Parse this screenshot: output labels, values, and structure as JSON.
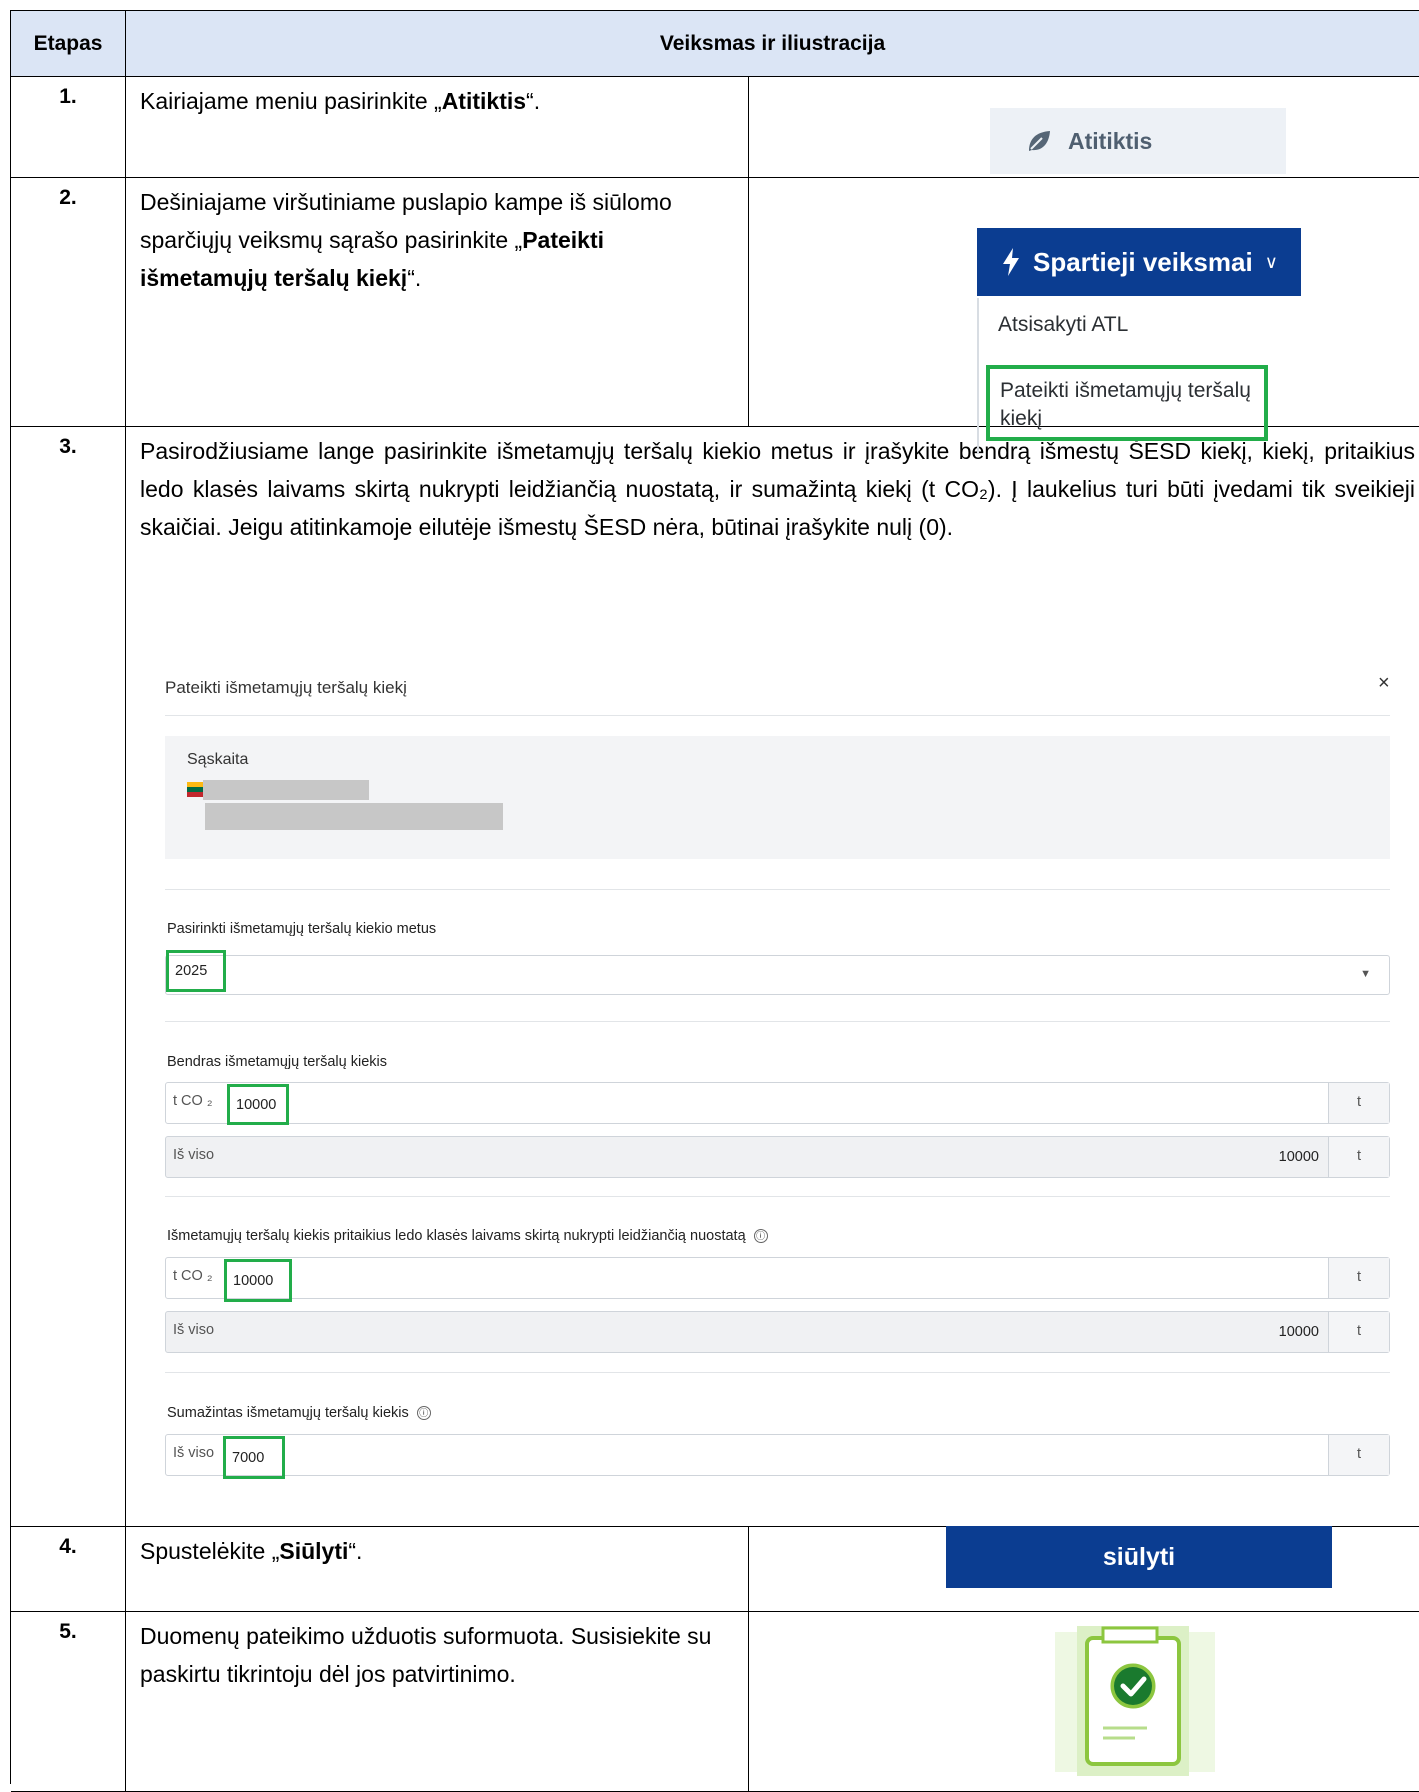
{
  "header": {
    "col1": "Etapas",
    "col2": "Veiksmas ir iliustracija"
  },
  "steps": [
    {
      "num": "1.",
      "pre": "Kairiajame meniu pasirinkite „",
      "bold": "Atitiktis",
      "post": "“."
    },
    {
      "num": "2.",
      "pre": "Dešiniajame viršutiniame puslapio kampe  iš siūlomo sparčiųjų veiksmų sąrašo pasirinkite „",
      "bold": "Pateikti išmetamųjų teršalų kiekį",
      "post": "“."
    },
    {
      "num": "3.",
      "text": "Pasirodžiusiame lange pasirinkite išmetamųjų teršalų kiekio metus ir įrašykite bendrą išmestų ŠESD kiekį, kiekį, pritaikius ledo klasės laivams skirtą nukrypti leidžiančią nuostatą, ir sumažintą kiekį (t CO₂). Į laukelius turi būti įvedami tik sveikieji skaičiai. Jeigu atitinkamoje eilutėje išmestų ŠESD nėra, būtinai įrašykite nulį (0)."
    },
    {
      "num": "4.",
      "pre": "Spustelėkite „",
      "bold": "Siūlyti",
      "post": "“."
    },
    {
      "num": "5.",
      "text": "Duomenų pateikimo užduotis suformuota. Susisiekite su paskirtu tikrintoju dėl jos patvirtinimo."
    }
  ],
  "step1_illustration": {
    "label": "Atitiktis",
    "icon": "leaf-icon"
  },
  "step2_illustration": {
    "button": "Spartieji veiksmai",
    "items": [
      "Atsisakyti ATL",
      "Pateikti išmetamųjų teršalų kiekį"
    ]
  },
  "form": {
    "title": "Pateikti išmetamųjų teršalų kiekį",
    "close": "×",
    "account_label": "Sąskaita",
    "year_label": "Pasirinkti išmetamųjų teršalų kiekio metus",
    "year_value": "2025",
    "total_label": "Bendras išmetamųjų teršalų kiekis",
    "ice_label": "Išmetamųjų teršalų kiekis pritaikius ledo klasės laivams skirtą nukrypti leidžiančią nuostatą",
    "reduced_label": "Sumažintas išmetamųjų teršalų kiekis",
    "prefix_tco2": "t CO ₂",
    "prefix_total": "Iš viso",
    "unit": "t",
    "info_glyph": "ⓘ",
    "total_value": "10000",
    "total_sum": "10000",
    "ice_value": "10000",
    "ice_sum": "10000",
    "reduced_value": "7000"
  },
  "step4_illustration": {
    "button": "siūlyti"
  },
  "step5_illustration": {
    "icon": "document-check-icon"
  },
  "colors": {
    "header_bg": "#dbe5f5",
    "brand_blue": "#0b3d91",
    "highlight_green": "#22ad4a"
  }
}
